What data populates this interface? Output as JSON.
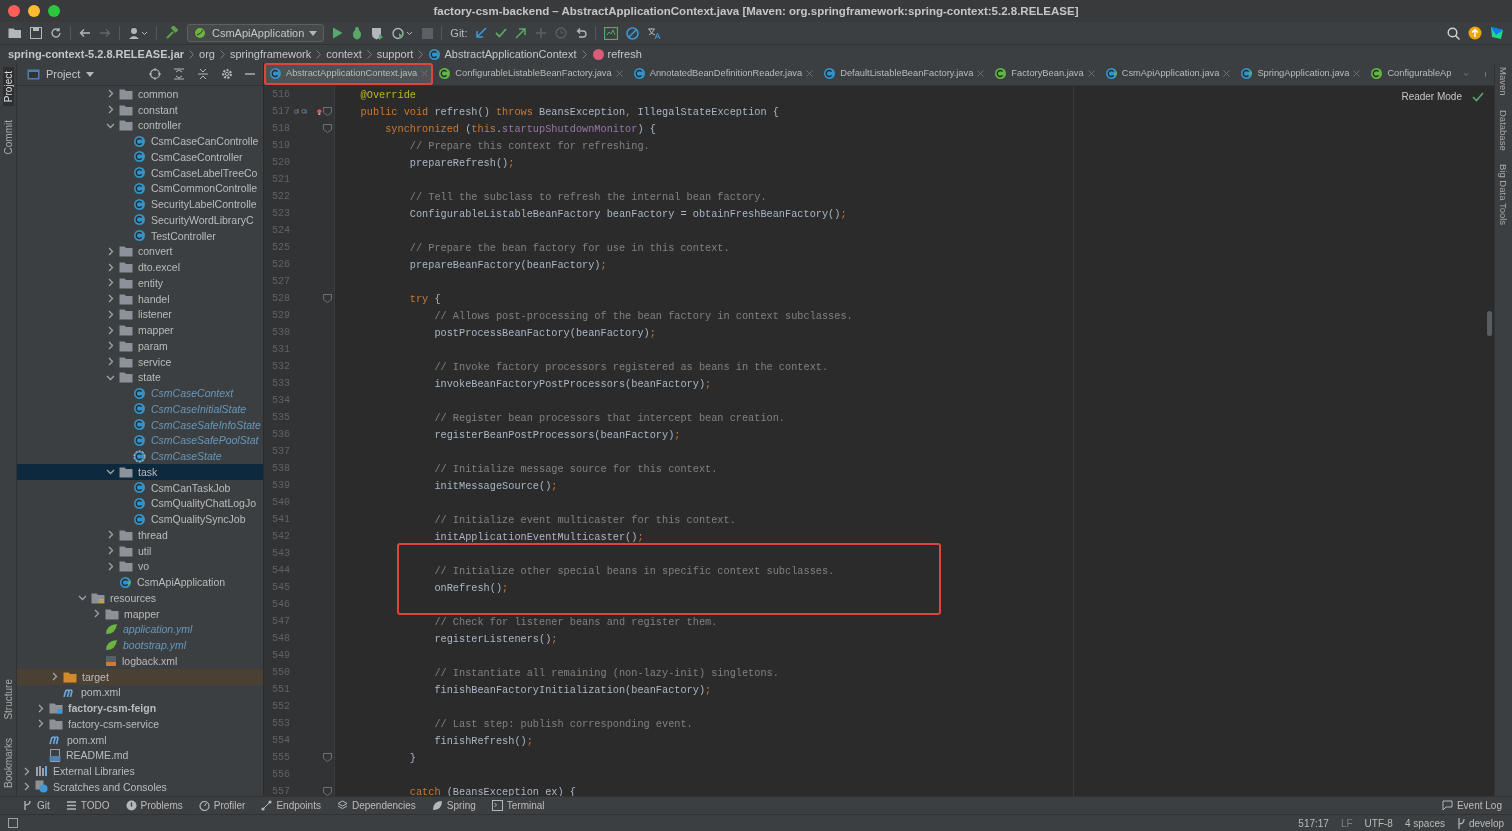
{
  "window": {
    "title": "factory-csm-backend – AbstractApplicationContext.java [Maven: org.springframework:spring-context:5.2.8.RELEASE]"
  },
  "toolbar": {
    "run_config": "CsmApiApplication",
    "git_label": "Git:"
  },
  "breadcrumbs": [
    {
      "label": "spring-context-5.2.8.RELEASE.jar",
      "kind": "jar"
    },
    {
      "label": "org",
      "kind": "package"
    },
    {
      "label": "springframework",
      "kind": "package"
    },
    {
      "label": "context",
      "kind": "package"
    },
    {
      "label": "support",
      "kind": "package"
    },
    {
      "label": "AbstractApplicationContext",
      "kind": "class"
    },
    {
      "label": "refresh",
      "kind": "method"
    }
  ],
  "left_strip": {
    "top": [
      {
        "label": "Project",
        "selected": true
      },
      {
        "label": "Commit",
        "selected": false
      }
    ],
    "bottom": [
      {
        "label": "Structure",
        "selected": false
      },
      {
        "label": "Bookmarks",
        "selected": false
      }
    ]
  },
  "right_strip": [
    {
      "label": "Maven"
    },
    {
      "label": "Database"
    },
    {
      "label": "Big Data Tools"
    }
  ],
  "project_panel": {
    "title": "Project",
    "tree": [
      {
        "children": [
          {
            "children": [
              {
                "children": [
                  {
                    "children": [
                      {
                        "children": [
                          {
                            "children": [
                              {
                                "label": "common",
                                "kind": "folder",
                                "expanded": false,
                                "selected": false,
                                "modified": false
                              },
                              {
                                "label": "constant",
                                "kind": "folder",
                                "expanded": false,
                                "selected": false,
                                "modified": false
                              },
                              {
                                "label": "controller",
                                "kind": "folder",
                                "expanded": true,
                                "selected": false,
                                "modified": false,
                                "children": [
                                  {
                                    "label": "CsmCaseCanControlle",
                                    "kind": "class",
                                    "selected": false,
                                    "modified": false
                                  },
                                  {
                                    "label": "CsmCaseController",
                                    "kind": "class",
                                    "selected": false,
                                    "modified": false
                                  },
                                  {
                                    "label": "CsmCaseLabelTreeCo",
                                    "kind": "class",
                                    "selected": false,
                                    "modified": false
                                  },
                                  {
                                    "label": "CsmCommonControlle",
                                    "kind": "class",
                                    "selected": false,
                                    "modified": false
                                  },
                                  {
                                    "label": "SecurityLabelControlle",
                                    "kind": "class",
                                    "selected": false,
                                    "modified": false
                                  },
                                  {
                                    "label": "SecurityWordLibraryC",
                                    "kind": "class",
                                    "selected": false,
                                    "modified": false
                                  },
                                  {
                                    "label": "TestController",
                                    "kind": "class",
                                    "selected": false,
                                    "modified": false
                                  }
                                ]
                              },
                              {
                                "label": "convert",
                                "kind": "folder",
                                "expanded": false,
                                "selected": false,
                                "modified": false
                              },
                              {
                                "label": "dto.excel",
                                "kind": "folder",
                                "expanded": false,
                                "selected": false,
                                "modified": false
                              },
                              {
                                "label": "entity",
                                "kind": "folder",
                                "expanded": false,
                                "selected": false,
                                "modified": false
                              },
                              {
                                "label": "handel",
                                "kind": "folder",
                                "expanded": false,
                                "selected": false,
                                "modified": false
                              },
                              {
                                "label": "listener",
                                "kind": "folder",
                                "expanded": false,
                                "selected": false,
                                "modified": false
                              },
                              {
                                "label": "mapper",
                                "kind": "folder",
                                "expanded": false,
                                "selected": false,
                                "modified": false
                              },
                              {
                                "label": "param",
                                "kind": "folder",
                                "expanded": false,
                                "selected": false,
                                "modified": false
                              },
                              {
                                "label": "service",
                                "kind": "folder",
                                "expanded": false,
                                "selected": false,
                                "modified": false
                              },
                              {
                                "label": "state",
                                "kind": "folder",
                                "expanded": true,
                                "selected": false,
                                "modified": false,
                                "children": [
                                  {
                                    "label": "CsmCaseContext",
                                    "kind": "class",
                                    "selected": false,
                                    "modified": true
                                  },
                                  {
                                    "label": "CsmCaseInitialState",
                                    "kind": "class",
                                    "selected": false,
                                    "modified": true
                                  },
                                  {
                                    "label": "CsmCaseSafeInfoState",
                                    "kind": "class",
                                    "selected": false,
                                    "modified": true
                                  },
                                  {
                                    "label": "CsmCaseSafePoolStat",
                                    "kind": "class",
                                    "selected": false,
                                    "modified": true
                                  },
                                  {
                                    "label": "CsmCaseState",
                                    "kind": "abstract-class",
                                    "selected": false,
                                    "modified": true
                                  }
                                ]
                              },
                              {
                                "label": "task",
                                "kind": "folder",
                                "expanded": true,
                                "selected": true,
                                "modified": false,
                                "children": [
                                  {
                                    "label": "CsmCanTaskJob",
                                    "kind": "class",
                                    "selected": false,
                                    "modified": false
                                  },
                                  {
                                    "label": "CsmQualityChatLogJo",
                                    "kind": "class",
                                    "selected": false,
                                    "modified": false
                                  },
                                  {
                                    "label": "CsmQualitySyncJob",
                                    "kind": "class",
                                    "selected": false,
                                    "modified": false
                                  }
                                ]
                              },
                              {
                                "label": "thread",
                                "kind": "folder",
                                "expanded": false,
                                "selected": false,
                                "modified": false
                              },
                              {
                                "label": "util",
                                "kind": "folder",
                                "expanded": false,
                                "selected": false,
                                "modified": false
                              },
                              {
                                "label": "vo",
                                "kind": "folder",
                                "expanded": false,
                                "selected": false,
                                "modified": false
                              },
                              {
                                "label": "CsmApiApplication",
                                "kind": "spring-class",
                                "selected": false,
                                "modified": false
                              }
                            ]
                          }
                        ]
                      },
                      {
                        "label": "resources",
                        "kind": "resources-folder",
                        "expanded": true,
                        "selected": false,
                        "modified": false,
                        "children": [
                          {
                            "label": "mapper",
                            "kind": "folder",
                            "expanded": false,
                            "selected": false,
                            "modified": false
                          },
                          {
                            "label": "application.yml",
                            "kind": "yml",
                            "selected": false,
                            "modified": true
                          },
                          {
                            "label": "bootstrap.yml",
                            "kind": "yml",
                            "selected": false,
                            "modified": true
                          },
                          {
                            "label": "logback.xml",
                            "kind": "xml",
                            "selected": false,
                            "modified": false
                          }
                        ]
                      }
                    ]
                  }
                ]
              },
              {
                "label": "target",
                "kind": "excluded-folder",
                "expanded": false,
                "selected": false,
                "modified": false
              },
              {
                "label": "pom.xml",
                "kind": "maven",
                "selected": false,
                "modified": false
              }
            ]
          },
          {
            "label": "factory-csm-feign",
            "kind": "module",
            "expanded": false,
            "selected": false,
            "modified": false
          },
          {
            "label": "factory-csm-service",
            "kind": "folder",
            "expanded": false,
            "selected": false,
            "modified": false
          },
          {
            "label": "pom.xml",
            "kind": "maven",
            "selected": false,
            "modified": false
          },
          {
            "label": "README.md",
            "kind": "markdown",
            "selected": false,
            "modified": false
          }
        ]
      },
      {
        "label": "External Libraries",
        "kind": "libraries",
        "expanded": false,
        "selected": false,
        "modified": false
      },
      {
        "label": "Scratches and Consoles",
        "kind": "scratches",
        "expanded": false,
        "selected": false,
        "modified": false
      }
    ]
  },
  "tabs": [
    {
      "label": "AbstractApplicationContext.java",
      "kind": "class",
      "selected": true,
      "annotated": true,
      "cut": false
    },
    {
      "label": "ConfigurableListableBeanFactory.java",
      "kind": "interface",
      "selected": false,
      "annotated": false,
      "cut": false
    },
    {
      "label": "AnnotatedBeanDefinitionReader.java",
      "kind": "class",
      "selected": false,
      "annotated": false,
      "cut": false
    },
    {
      "label": "DefaultListableBeanFactory.java",
      "kind": "class",
      "selected": false,
      "annotated": false,
      "cut": false
    },
    {
      "label": "FactoryBean.java",
      "kind": "interface",
      "selected": false,
      "annotated": false,
      "cut": false
    },
    {
      "label": "CsmApiApplication.java",
      "kind": "spring-class",
      "selected": false,
      "annotated": false,
      "cut": false
    },
    {
      "label": "SpringApplication.java",
      "kind": "spring-class",
      "selected": false,
      "annotated": false,
      "cut": false
    },
    {
      "label": "ConfigurableAp",
      "kind": "interface",
      "selected": false,
      "annotated": false,
      "cut": true
    }
  ],
  "reader_mode": "Reader Mode",
  "code": [
    {
      "kind": "plain",
      "lines": [
        {
          "number": "516",
          "tokens": [
            {
              "text": "    @Override",
              "kind": "annotation"
            }
          ]
        },
        {
          "number": "517",
          "gutter_icons": [
            {
              "kind": "override"
            },
            {
              "kind": "implemented"
            },
            {
              "kind": "bulb"
            },
            {
              "kind": "fold"
            }
          ],
          "tokens": [
            {
              "text": "    public void ",
              "kind": "keyword"
            },
            {
              "text": "refresh() ",
              "kind": "plain"
            },
            {
              "text": "throws ",
              "kind": "keyword"
            },
            {
              "text": "BeansException",
              "kind": "plain"
            },
            {
              "text": ",",
              "kind": "punct"
            },
            {
              "text": " IllegalStateException {",
              "kind": "plain"
            }
          ]
        },
        {
          "number": "518",
          "gutter_icons": [
            {
              "kind": "fold"
            }
          ],
          "tokens": [
            {
              "text": "        synchronized ",
              "kind": "keyword"
            },
            {
              "text": "(",
              "kind": "plain"
            },
            {
              "text": "this",
              "kind": "keyword"
            },
            {
              "text": ".",
              "kind": "plain"
            },
            {
              "text": "startupShutdownMonitor",
              "kind": "field"
            },
            {
              "text": ") {",
              "kind": "plain"
            }
          ]
        },
        {
          "number": "519",
          "tokens": [
            {
              "text": "            // Prepare this context for refreshing.",
              "kind": "comment"
            }
          ]
        },
        {
          "number": "520",
          "tokens": [
            {
              "text": "            prepareRefresh()",
              "kind": "plain"
            },
            {
              "text": ";",
              "kind": "punct"
            }
          ]
        },
        {
          "number": "521"
        },
        {
          "number": "522",
          "tokens": [
            {
              "text": "            // Tell the subclass to refresh the internal bean factory.",
              "kind": "comment"
            }
          ]
        },
        {
          "number": "523",
          "tokens": [
            {
              "text": "            ConfigurableListableBeanFactory beanFactory = obtainFreshBeanFactory()",
              "kind": "plain"
            },
            {
              "text": ";",
              "kind": "punct"
            }
          ]
        },
        {
          "number": "524"
        },
        {
          "number": "525",
          "tokens": [
            {
              "text": "            // Prepare the bean factory for use in this context.",
              "kind": "comment"
            }
          ]
        },
        {
          "number": "526",
          "tokens": [
            {
              "text": "            prepareBeanFactory(beanFactory)",
              "kind": "plain"
            },
            {
              "text": ";",
              "kind": "punct"
            }
          ]
        },
        {
          "number": "527"
        },
        {
          "number": "528",
          "gutter_icons": [
            {
              "kind": "fold"
            }
          ],
          "tokens": [
            {
              "text": "            try ",
              "kind": "keyword"
            },
            {
              "text": "{",
              "kind": "plain"
            }
          ]
        },
        {
          "number": "529",
          "tokens": [
            {
              "text": "                // Allows post-processing of the bean factory in context subclasses.",
              "kind": "comment"
            }
          ]
        },
        {
          "number": "530",
          "tokens": [
            {
              "text": "                postProcessBeanFactory(beanFactory)",
              "kind": "plain"
            },
            {
              "text": ";",
              "kind": "punct"
            }
          ]
        },
        {
          "number": "531"
        },
        {
          "number": "532",
          "tokens": [
            {
              "text": "                // Invoke factory processors registered as beans in the context.",
              "kind": "comment"
            }
          ]
        },
        {
          "number": "533",
          "tokens": [
            {
              "text": "                invokeBeanFactoryPostProcessors(beanFactory)",
              "kind": "plain"
            },
            {
              "text": ";",
              "kind": "punct"
            }
          ]
        },
        {
          "number": "534"
        },
        {
          "number": "535",
          "tokens": [
            {
              "text": "                // Register bean processors that intercept bean creation.",
              "kind": "comment"
            }
          ]
        },
        {
          "number": "536",
          "tokens": [
            {
              "text": "                registerBeanPostProcessors(beanFactory)",
              "kind": "plain"
            },
            {
              "text": ";",
              "kind": "punct"
            }
          ]
        },
        {
          "number": "537"
        },
        {
          "number": "538",
          "tokens": [
            {
              "text": "                // Initialize message source for this context.",
              "kind": "comment"
            }
          ]
        },
        {
          "number": "539",
          "tokens": [
            {
              "text": "                initMessageSource()",
              "kind": "plain"
            },
            {
              "text": ";",
              "kind": "punct"
            }
          ]
        },
        {
          "number": "540"
        },
        {
          "number": "541",
          "tokens": [
            {
              "text": "                // Initialize event multicaster for this context.",
              "kind": "comment"
            }
          ]
        },
        {
          "number": "542",
          "tokens": [
            {
              "text": "                initApplicationEventMulticaster()",
              "kind": "plain"
            },
            {
              "text": ";",
              "kind": "punct"
            }
          ]
        }
      ]
    },
    {
      "kind": "boxed",
      "lines": [
        {
          "number": "543"
        },
        {
          "number": "544",
          "tokens": [
            {
              "text": "                // Initialize other special beans in specific context subclasses.",
              "kind": "comment"
            }
          ]
        },
        {
          "number": "545",
          "tokens": [
            {
              "text": "                onRefresh()",
              "kind": "plain"
            },
            {
              "text": ";",
              "kind": "punct"
            }
          ]
        },
        {
          "number": "546"
        }
      ]
    },
    {
      "kind": "plain",
      "lines": [
        {
          "number": "547",
          "tokens": [
            {
              "text": "                // Check for listener beans and register them.",
              "kind": "comment"
            }
          ]
        },
        {
          "number": "548",
          "tokens": [
            {
              "text": "                registerListeners()",
              "kind": "plain"
            },
            {
              "text": ";",
              "kind": "punct"
            }
          ]
        },
        {
          "number": "549"
        },
        {
          "number": "550",
          "tokens": [
            {
              "text": "                // Instantiate all remaining (non-lazy-init) singletons.",
              "kind": "comment"
            }
          ]
        },
        {
          "number": "551",
          "tokens": [
            {
              "text": "                finishBeanFactoryInitialization(beanFactory)",
              "kind": "plain"
            },
            {
              "text": ";",
              "kind": "punct"
            }
          ]
        },
        {
          "number": "552"
        },
        {
          "number": "553",
          "tokens": [
            {
              "text": "                // Last step: publish corresponding event.",
              "kind": "comment"
            }
          ]
        },
        {
          "number": "554",
          "tokens": [
            {
              "text": "                finishRefresh()",
              "kind": "plain"
            },
            {
              "text": ";",
              "kind": "punct"
            }
          ]
        },
        {
          "number": "555",
          "gutter_icons": [
            {
              "kind": "fold"
            }
          ],
          "tokens": [
            {
              "text": "            }",
              "kind": "plain"
            }
          ]
        },
        {
          "number": "556"
        },
        {
          "number": "557",
          "gutter_icons": [
            {
              "kind": "fold"
            }
          ],
          "tokens": [
            {
              "text": "            catch ",
              "kind": "keyword"
            },
            {
              "text": "(BeansException ex) {",
              "kind": "plain"
            }
          ]
        }
      ]
    }
  ],
  "tool_windows": [
    {
      "label": "Git",
      "kind": "git"
    },
    {
      "label": "TODO",
      "kind": "todo"
    },
    {
      "label": "Problems",
      "kind": "problems"
    },
    {
      "label": "Profiler",
      "kind": "profiler"
    },
    {
      "label": "Endpoints",
      "kind": "endpoints"
    },
    {
      "label": "Dependencies",
      "kind": "dependencies"
    },
    {
      "label": "Spring",
      "kind": "spring"
    },
    {
      "label": "Terminal",
      "kind": "terminal"
    }
  ],
  "event_log": "Event Log",
  "status_bar": {
    "position": "517:17",
    "line_ending": "LF",
    "encoding": "UTF-8",
    "indent": "4 spaces",
    "branch": "develop"
  }
}
